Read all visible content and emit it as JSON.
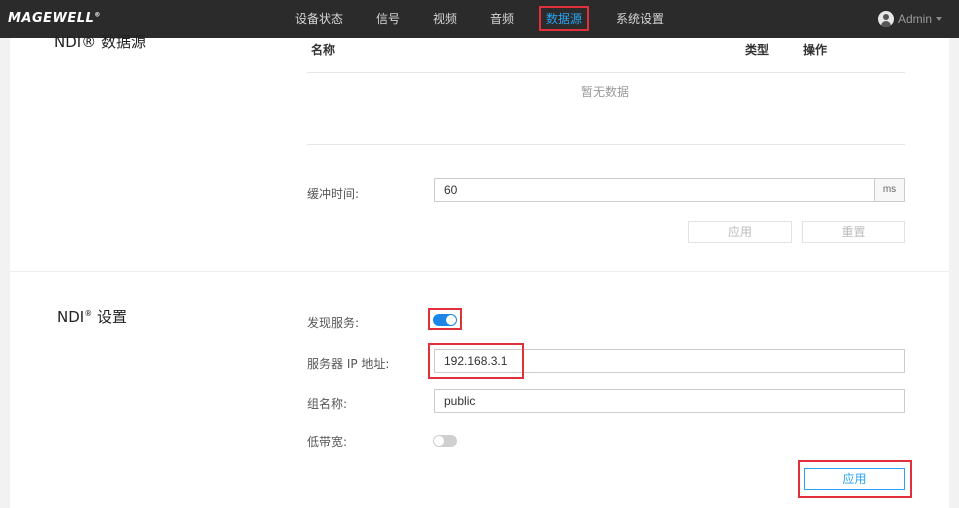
{
  "brand": {
    "logo": "MAGEWELL",
    "logo_mark": "®"
  },
  "nav": {
    "items": [
      {
        "label": "设备状态"
      },
      {
        "label": "信号"
      },
      {
        "label": "视频"
      },
      {
        "label": "音频"
      },
      {
        "label": "数据源",
        "active": true
      },
      {
        "label": "系统设置"
      }
    ]
  },
  "user": {
    "name": "Admin"
  },
  "ndi_sources": {
    "title": "NDI® 数据源",
    "columns": {
      "name": "名称",
      "type": "类型",
      "action": "操作"
    },
    "empty_text": "暂无数据",
    "buffer_label": "缓冲时间:",
    "buffer_value": "60",
    "buffer_unit": "ms",
    "apply_label": "应用",
    "reset_label": "重置"
  },
  "ndi_settings": {
    "title_main": "NDI",
    "title_mark": "®",
    "title_rest": " 设置",
    "discovery_label": "发现服务:",
    "discovery_on": true,
    "server_ip_label": "服务器 IP 地址:",
    "server_ip_value": "192.168.3.1",
    "group_label": "组名称:",
    "group_value": "public",
    "low_bandwidth_label": "低带宽:",
    "low_bandwidth_on": false,
    "apply_label": "应用"
  },
  "colors": {
    "accent": "#29a3f2",
    "highlight": "#e0303c",
    "topbar": "#2b2b2b",
    "toggle_on": "#1a86e8"
  }
}
